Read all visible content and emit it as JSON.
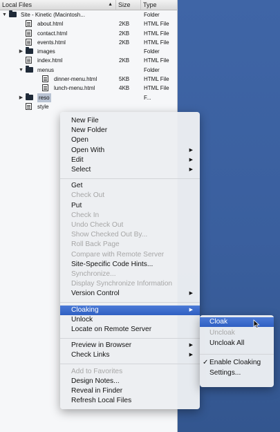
{
  "panel": {
    "headers": {
      "name": "Local Files",
      "size": "Size",
      "type": "Type",
      "sort_indicator": "▲"
    },
    "rows": [
      {
        "name": "Site - Kinetic (Macintosh...",
        "size": "",
        "type": "Folder",
        "kind": "folder",
        "expanded": "open"
      },
      {
        "name": "about.html",
        "size": "2KB",
        "type": "HTML File",
        "kind": "file"
      },
      {
        "name": "contact.html",
        "size": "2KB",
        "type": "HTML File",
        "kind": "file"
      },
      {
        "name": "events.html",
        "size": "2KB",
        "type": "HTML File",
        "kind": "file"
      },
      {
        "name": "images",
        "size": "",
        "type": "Folder",
        "kind": "folder",
        "expanded": "closed"
      },
      {
        "name": "index.html",
        "size": "2KB",
        "type": "HTML File",
        "kind": "file"
      },
      {
        "name": "menus",
        "size": "",
        "type": "Folder",
        "kind": "folder",
        "expanded": "open"
      },
      {
        "name": "dinner-menu.html",
        "size": "5KB",
        "type": "HTML File",
        "kind": "file"
      },
      {
        "name": "lunch-menu.html",
        "size": "4KB",
        "type": "HTML File",
        "kind": "file"
      },
      {
        "name": "reso",
        "size": "",
        "type": "F...",
        "kind": "folder",
        "expanded": "closed",
        "selected": true
      },
      {
        "name": "style",
        "size": "",
        "type": "",
        "kind": "file"
      }
    ]
  },
  "context_menu": {
    "items": [
      {
        "label": "New File"
      },
      {
        "label": "New Folder"
      },
      {
        "label": "Open"
      },
      {
        "label": "Open With",
        "submenu": true
      },
      {
        "label": "Edit",
        "submenu": true
      },
      {
        "label": "Select",
        "submenu": true
      },
      {
        "separator": true
      },
      {
        "label": "Get"
      },
      {
        "label": "Check Out",
        "disabled": true
      },
      {
        "label": "Put"
      },
      {
        "label": "Check In",
        "disabled": true
      },
      {
        "label": "Undo Check Out",
        "disabled": true
      },
      {
        "label": "Show Checked Out By...",
        "disabled": true
      },
      {
        "label": "Roll Back Page",
        "disabled": true
      },
      {
        "label": "Compare with Remote Server",
        "disabled": true
      },
      {
        "label": "Site-Specific Code Hints..."
      },
      {
        "label": "Synchronize...",
        "disabled": true
      },
      {
        "label": "Display Synchronize Information",
        "disabled": true
      },
      {
        "label": "Version Control",
        "submenu": true
      },
      {
        "separator": true
      },
      {
        "label": "Cloaking",
        "submenu": true,
        "highlighted": true
      },
      {
        "label": "Unlock"
      },
      {
        "label": "Locate on Remote Server"
      },
      {
        "separator": true
      },
      {
        "label": "Preview in Browser",
        "submenu": true
      },
      {
        "label": "Check Links",
        "submenu": true
      },
      {
        "separator": true
      },
      {
        "label": "Add to Favorites",
        "disabled": true
      },
      {
        "label": "Design Notes..."
      },
      {
        "label": "Reveal in Finder"
      },
      {
        "label": "Refresh Local Files"
      }
    ]
  },
  "submenu": {
    "items": [
      {
        "label": "Cloak",
        "highlighted": true
      },
      {
        "label": "Uncloak",
        "disabled": true
      },
      {
        "label": "Uncloak All"
      },
      {
        "separator": true
      },
      {
        "label": "Enable Cloaking",
        "checked": true,
        "check_mark": "✓"
      },
      {
        "label": "Settings..."
      }
    ]
  },
  "colors": {
    "desktop": "#3a5f9e",
    "highlight": "#3b6bd0"
  }
}
